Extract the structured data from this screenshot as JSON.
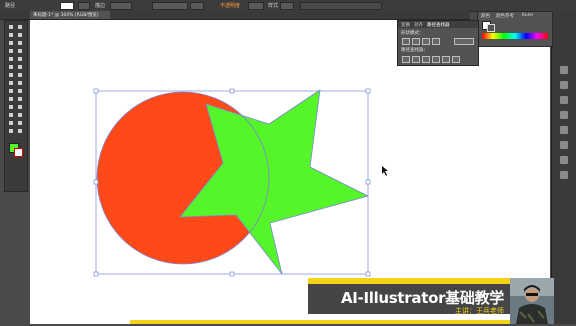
{
  "app": {
    "menu_label": "路径",
    "tab_label": "未标题-1* @ 300% (RGB/预览)",
    "close_glyph": "×"
  },
  "controlbar": {
    "stroke_label": "描边",
    "opacity_label": "不透明度",
    "style_label": "样式"
  },
  "panels": {
    "color_tabs": [
      "颜色",
      "颜色参考",
      "Kuler"
    ],
    "pathfinder_tabs": [
      "变换",
      "对齐",
      "路径查找器"
    ],
    "shape_modes_label": "形状模式：",
    "pathfinders_label": "路径查找器："
  },
  "artwork": {
    "circle_color": "#ff4a17",
    "star_color": "#55f52a",
    "selection_color": "#7c86d9"
  },
  "banner": {
    "title": "AI-Illustrator基础教学",
    "subtitle": "主讲：王兵老师",
    "accent_color": "#f5d21a"
  },
  "icons": {
    "tools": [
      "selection-tool-icon",
      "direct-selection-tool-icon",
      "magic-wand-tool-icon",
      "lasso-tool-icon",
      "pen-tool-icon",
      "type-tool-icon",
      "line-tool-icon",
      "rectangle-tool-icon",
      "paintbrush-tool-icon",
      "pencil-tool-icon",
      "blob-brush-tool-icon",
      "eraser-tool-icon",
      "rotate-tool-icon",
      "scale-tool-icon",
      "width-tool-icon",
      "free-transform-tool-icon",
      "shape-builder-tool-icon",
      "perspective-grid-tool-icon",
      "mesh-tool-icon",
      "gradient-tool-icon",
      "eyedropper-tool-icon",
      "blend-tool-icon",
      "symbol-sprayer-tool-icon",
      "column-graph-tool-icon",
      "artboard-tool-icon",
      "slice-tool-icon",
      "hand-tool-icon",
      "zoom-tool-icon"
    ]
  }
}
